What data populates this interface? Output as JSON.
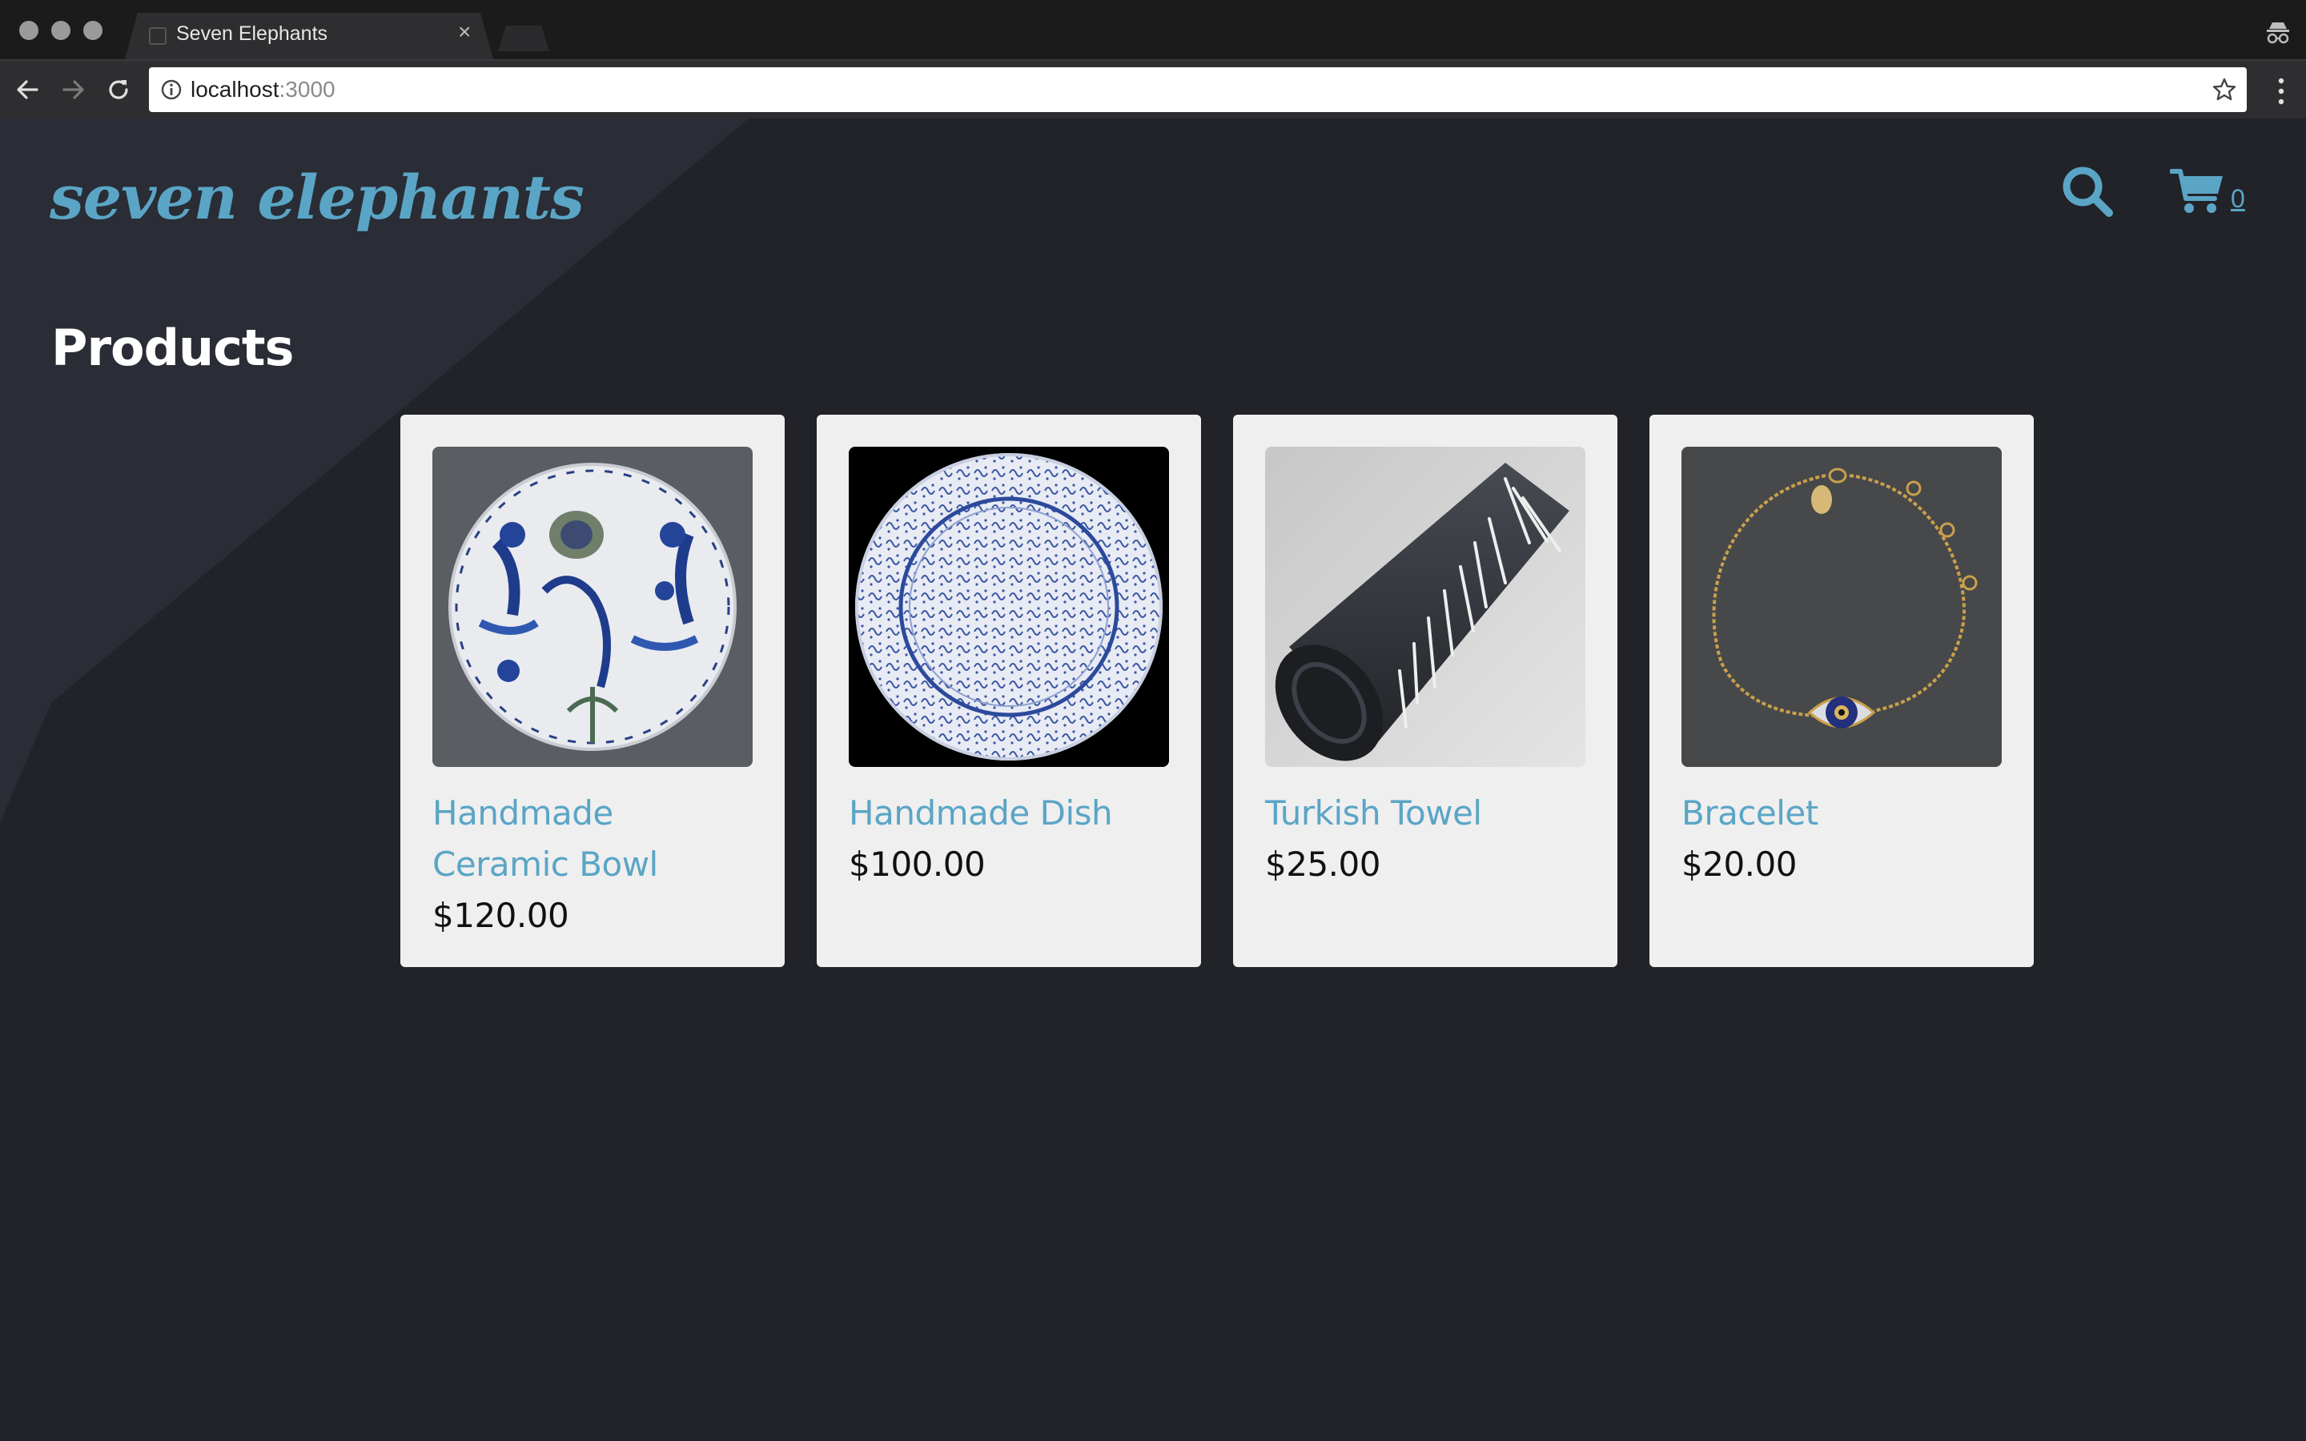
{
  "browser": {
    "tab_title": "Seven Elephants",
    "tab_close": "×",
    "url_host": "localhost",
    "url_port": ":3000"
  },
  "header": {
    "logo": "seven elephants",
    "cart_count": "0"
  },
  "main": {
    "title": "Products",
    "products": [
      {
        "name": "Handmade Ceramic Bowl",
        "price": "$120.00",
        "image": "ceramic-bowl-image"
      },
      {
        "name": "Handmade Dish",
        "price": "$100.00",
        "image": "handmade-dish-image"
      },
      {
        "name": "Turkish Towel",
        "price": "$25.00",
        "image": "turkish-towel-image"
      },
      {
        "name": "Bracelet",
        "price": "$20.00",
        "image": "bracelet-image"
      }
    ]
  },
  "colors": {
    "page_bg": "#212329",
    "accent": "#5aa5c6",
    "card_bg": "#efefef"
  }
}
